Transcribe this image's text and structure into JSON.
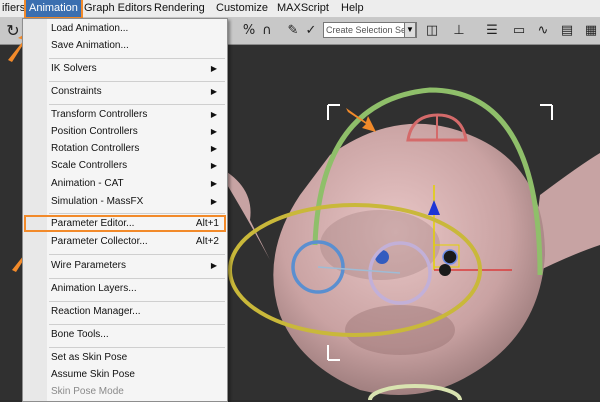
{
  "menubar": {
    "items": [
      {
        "label": "ifiers"
      },
      {
        "label": "Animation"
      },
      {
        "label": "Graph Editors"
      },
      {
        "label": "Rendering"
      },
      {
        "label": "Customize"
      },
      {
        "label": "MAXScript"
      },
      {
        "label": "Help"
      }
    ]
  },
  "toolbar": {
    "selection_set_placeholder": "Create Selection Se"
  },
  "menu": {
    "items": [
      {
        "label": "Load Animation..."
      },
      {
        "label": "Save Animation..."
      },
      {
        "label": "IK Solvers"
      },
      {
        "label": "Constraints"
      },
      {
        "label": "Transform Controllers"
      },
      {
        "label": "Position Controllers"
      },
      {
        "label": "Rotation Controllers"
      },
      {
        "label": "Scale Controllers"
      },
      {
        "label": "Animation - CAT"
      },
      {
        "label": "Simulation - MassFX"
      },
      {
        "label": "Parameter Editor...",
        "shortcut": "Alt+1"
      },
      {
        "label": "Parameter Collector...",
        "shortcut": "Alt+2"
      },
      {
        "label": "Wire Parameters"
      },
      {
        "label": "Animation Layers..."
      },
      {
        "label": "Reaction Manager..."
      },
      {
        "label": "Bone Tools..."
      },
      {
        "label": "Set as Skin Pose"
      },
      {
        "label": "Assume Skin Pose"
      },
      {
        "label": "Skin Pose Mode"
      }
    ]
  },
  "colors": {
    "highlight_outline": "#f28a2a",
    "menu_bg": "#f5f5f5",
    "active_menu_bg": "#3b6fb0"
  }
}
